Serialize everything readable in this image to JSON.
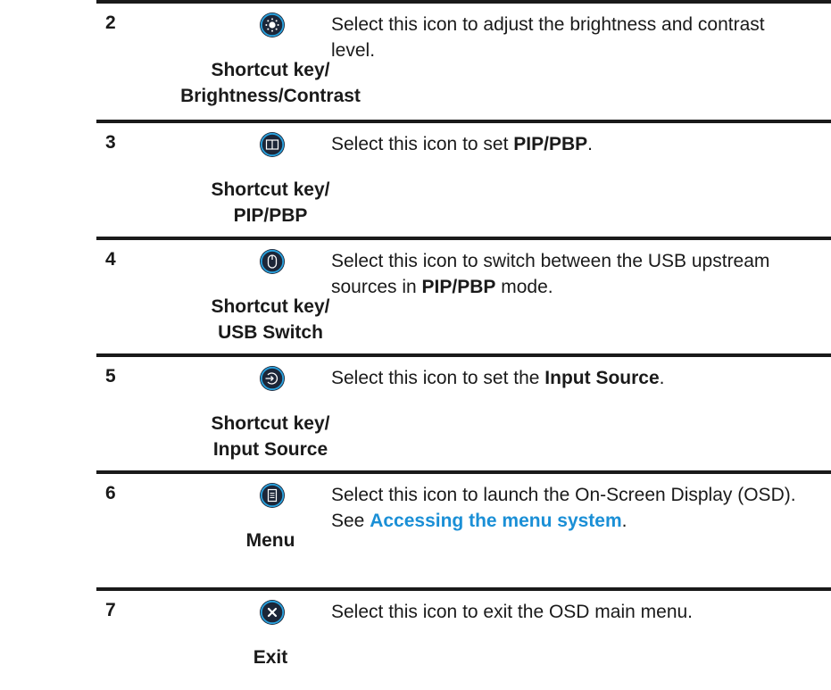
{
  "colors": {
    "rule": "#1a1a1a",
    "icon_bg": "#1c2638",
    "icon_ring": "#29a3e0",
    "link": "#1a8fd6"
  },
  "rows": [
    {
      "number": "2",
      "icon": "brightness-contrast-icon",
      "caption": "Shortcut key/\nBrightness/Contrast",
      "desc_parts": [
        {
          "text": "Select this icon to adjust the brightness and contrast level.",
          "style": "normal"
        }
      ]
    },
    {
      "number": "3",
      "icon": "pip-pbp-icon",
      "caption": "Shortcut key/\nPIP/PBP",
      "desc_parts": [
        {
          "text": "Select this icon to set ",
          "style": "normal"
        },
        {
          "text": "PIP/PBP",
          "style": "bold"
        },
        {
          "text": ".",
          "style": "normal"
        }
      ]
    },
    {
      "number": "4",
      "icon": "usb-switch-mouse-icon",
      "caption": "Shortcut key/\nUSB Switch",
      "desc_parts": [
        {
          "text": "Select this icon to switch between the USB upstream sources in ",
          "style": "normal"
        },
        {
          "text": "PIP/PBP",
          "style": "bold"
        },
        {
          "text": " mode.",
          "style": "normal"
        }
      ]
    },
    {
      "number": "5",
      "icon": "input-source-icon",
      "caption": "Shortcut key/\nInput Source",
      "desc_parts": [
        {
          "text": "Select this icon to set the ",
          "style": "normal"
        },
        {
          "text": "Input Source",
          "style": "bold"
        },
        {
          "text": ".",
          "style": "normal"
        }
      ]
    },
    {
      "number": "6",
      "icon": "menu-icon",
      "caption": "Menu",
      "desc_parts": [
        {
          "text": "Select this icon to launch the On-Screen Display (OSD). See ",
          "style": "normal"
        },
        {
          "text": "Accessing the menu system",
          "style": "link"
        },
        {
          "text": ".",
          "style": "normal"
        }
      ]
    },
    {
      "number": "7",
      "icon": "exit-icon",
      "caption": "Exit",
      "desc_parts": [
        {
          "text": "Select this icon to exit the OSD main menu.",
          "style": "normal"
        }
      ]
    }
  ]
}
